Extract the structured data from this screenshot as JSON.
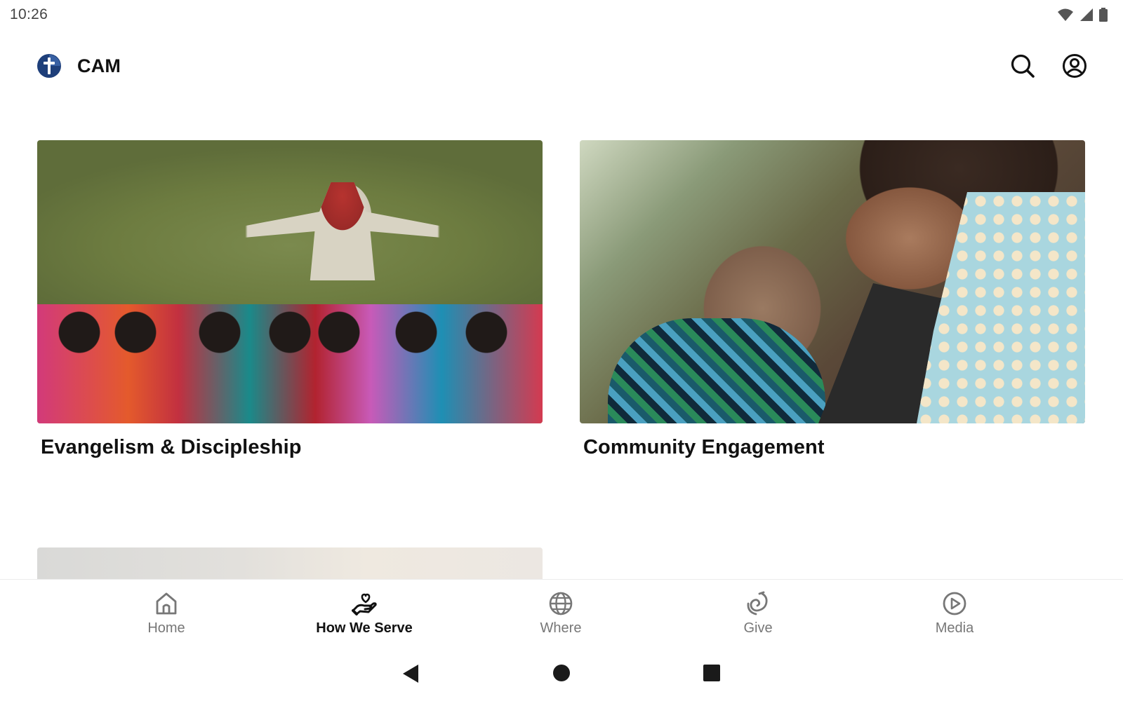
{
  "status_bar": {
    "time": "10:26",
    "icons": [
      "wifi-icon",
      "cell-signal-icon",
      "battery-icon"
    ]
  },
  "app_bar": {
    "logo_icon": "cross-logo-icon",
    "title": "CAM",
    "actions": [
      {
        "name": "search-icon"
      },
      {
        "name": "account-icon"
      }
    ]
  },
  "cards": [
    {
      "title": "Evangelism & Discipleship",
      "image": "photo of people praying on a hillside"
    },
    {
      "title": "Community Engagement",
      "image": "photo of woman being comforted"
    },
    {
      "title": "",
      "image": "partially visible photo"
    }
  ],
  "bottom_nav": {
    "items": [
      {
        "label": "Home",
        "icon": "home-icon",
        "active": false
      },
      {
        "label": "How We Serve",
        "icon": "hand-heart-icon",
        "active": true
      },
      {
        "label": "Where",
        "icon": "globe-icon",
        "active": false
      },
      {
        "label": "Give",
        "icon": "give-icon",
        "active": false
      },
      {
        "label": "Media",
        "icon": "play-circle-icon",
        "active": false
      }
    ]
  },
  "system_nav": {
    "buttons": [
      "back-icon",
      "home-circle-icon",
      "recents-icon"
    ]
  },
  "colors": {
    "logo_blue": "#1e3f7a",
    "active_label": "#111111",
    "inactive_label": "#777777",
    "background": "#ffffff"
  }
}
